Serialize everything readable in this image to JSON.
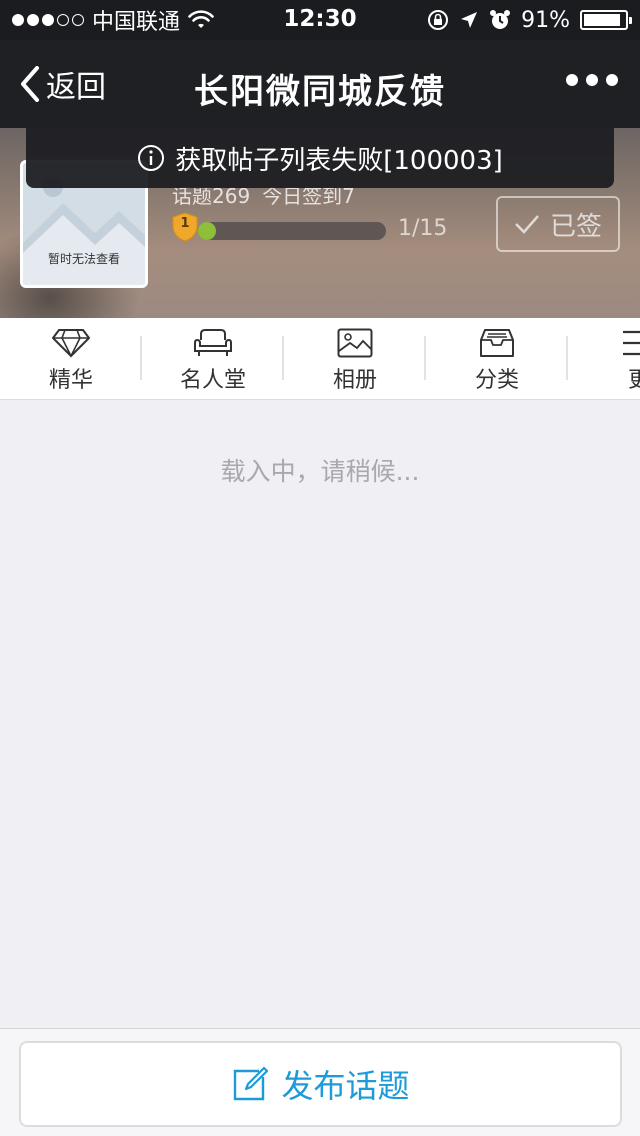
{
  "status_bar": {
    "carrier": "中国联通",
    "time": "12:30",
    "battery": "91%",
    "battery_level": 0.91,
    "signal_bars_filled": 3,
    "signal_bars_total": 5
  },
  "nav": {
    "back_label": "返回",
    "title": "长阳微同城反馈"
  },
  "toast": {
    "message": "获取帖子列表失败[100003]"
  },
  "header": {
    "avatar_caption": "暂时无法查看",
    "topics": "话题269",
    "checkins_today": "今日签到7",
    "level": "1",
    "progress_text": "1/15",
    "progress_fraction": 0.0667,
    "signed_label": "已签"
  },
  "tabs": [
    {
      "label": "精华",
      "icon": "diamond-icon"
    },
    {
      "label": "名人堂",
      "icon": "sofa-icon"
    },
    {
      "label": "相册",
      "icon": "image-icon"
    },
    {
      "label": "分类",
      "icon": "inbox-tray-icon"
    },
    {
      "label": "更",
      "icon": "menu-icon"
    }
  ],
  "loading_text": "载入中，请稍候...",
  "bottom": {
    "post_label": "发布话题"
  },
  "colors": {
    "accent": "#1d9bd8",
    "nav_bg": "#1f2024",
    "progress": "#8dbf3a",
    "badge": "#f0a82c"
  }
}
